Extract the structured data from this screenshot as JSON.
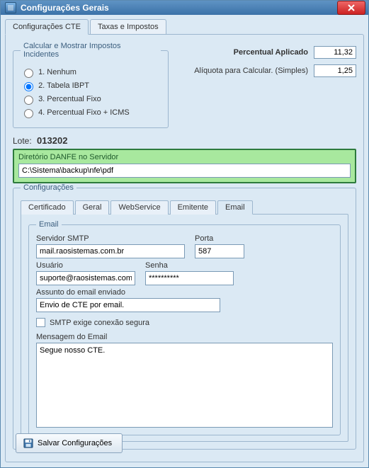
{
  "window": {
    "title": "Configurações Gerais"
  },
  "mainTabs": {
    "cte": "Configurações CTE",
    "taxas": "Taxas e Impostos"
  },
  "impostos": {
    "legend": "Calcular e Mostrar Impostos Incidentes",
    "options": {
      "nenhum": "1. Nenhum",
      "tabela": "2. Tabela IBPT",
      "percfixo": "3. Percentual Fixo",
      "percicms": "4. Percentual Fixo + ICMS"
    }
  },
  "percentual": {
    "aplicado_label": "Percentual Aplicado",
    "aplicado_value": "11,32",
    "aliquota_label": "Alíquota para Calcular. (Simples)",
    "aliquota_value": "1,25"
  },
  "lote": {
    "label": "Lote:",
    "value": "013202"
  },
  "danfe": {
    "header": "Diretório DANFE no Servidor",
    "path": "C:\\Sistema\\backup\\nfe\\pdf"
  },
  "config": {
    "legend": "Configurações",
    "subtabs": {
      "certificado": "Certificado",
      "geral": "Geral",
      "webservice": "WebService",
      "emitente": "Emitente",
      "email": "Email"
    }
  },
  "email": {
    "legend": "Email",
    "smtp_label": "Servidor SMTP",
    "smtp_value": "mail.raosistemas.com.br",
    "port_label": "Porta",
    "port_value": "587",
    "user_label": "Usuário",
    "user_value": "suporte@raosistemas.com.br",
    "pass_label": "Senha",
    "pass_value": "**********",
    "subject_label": "Assunto do email enviado",
    "subject_value": "Envio de CTE por email.",
    "secure_label": "SMTP exige conexão segura",
    "msg_label": "Mensagem do Email",
    "msg_value": "Segue nosso CTE."
  },
  "save_label": "Salvar Configurações"
}
